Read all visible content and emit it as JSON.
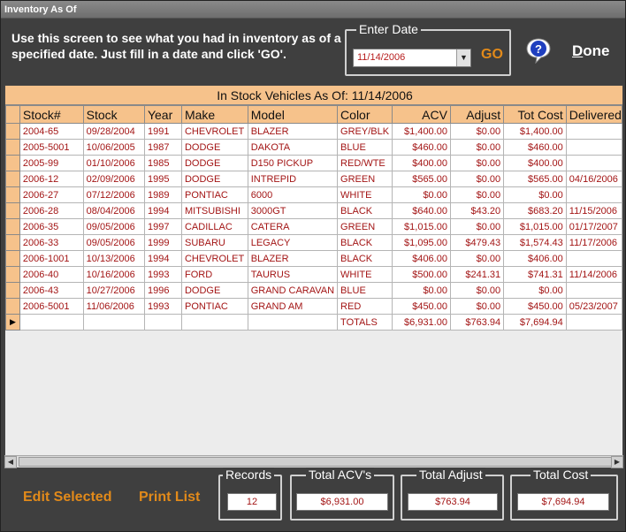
{
  "window": {
    "title": "Inventory As Of"
  },
  "instructions": "Use this screen to see what you had in inventory as of a specified date.  Just fill in a date and click 'GO'.",
  "date_picker": {
    "legend": "Enter Date",
    "value": "11/14/2006",
    "go_label": "GO"
  },
  "done_label_first": "D",
  "done_label_rest": "one",
  "grid": {
    "caption": "In Stock Vehicles As Of: 11/14/2006",
    "columns": [
      "Stock#",
      "Stock",
      "Year",
      "Make",
      "Model",
      "Color",
      "ACV",
      "Adjust",
      "Tot Cost",
      "Delivered"
    ],
    "rows": [
      [
        "2004-65",
        "09/28/2004",
        "1991",
        "CHEVROLET",
        "BLAZER",
        "GREY/BLK",
        "$1,400.00",
        "$0.00",
        "$1,400.00",
        ""
      ],
      [
        "2005-5001",
        "10/06/2005",
        "1987",
        "DODGE",
        "DAKOTA",
        "BLUE",
        "$460.00",
        "$0.00",
        "$460.00",
        ""
      ],
      [
        "2005-99",
        "01/10/2006",
        "1985",
        "DODGE",
        "D150 PICKUP",
        "RED/WTE",
        "$400.00",
        "$0.00",
        "$400.00",
        ""
      ],
      [
        "2006-12",
        "02/09/2006",
        "1995",
        "DODGE",
        "INTREPID",
        "GREEN",
        "$565.00",
        "$0.00",
        "$565.00",
        "04/16/2006"
      ],
      [
        "2006-27",
        "07/12/2006",
        "1989",
        "PONTIAC",
        "6000",
        "WHITE",
        "$0.00",
        "$0.00",
        "$0.00",
        ""
      ],
      [
        "2006-28",
        "08/04/2006",
        "1994",
        "MITSUBISHI",
        "3000GT",
        "BLACK",
        "$640.00",
        "$43.20",
        "$683.20",
        "11/15/2006"
      ],
      [
        "2006-35",
        "09/05/2006",
        "1997",
        "CADILLAC",
        "CATERA",
        "GREEN",
        "$1,015.00",
        "$0.00",
        "$1,015.00",
        "01/17/2007"
      ],
      [
        "2006-33",
        "09/05/2006",
        "1999",
        "SUBARU",
        "LEGACY",
        "BLACK",
        "$1,095.00",
        "$479.43",
        "$1,574.43",
        "11/17/2006"
      ],
      [
        "2006-1001",
        "10/13/2006",
        "1994",
        "CHEVROLET",
        "BLAZER",
        "BLACK",
        "$406.00",
        "$0.00",
        "$406.00",
        ""
      ],
      [
        "2006-40",
        "10/16/2006",
        "1993",
        "FORD",
        "TAURUS",
        "WHITE",
        "$500.00",
        "$241.31",
        "$741.31",
        "11/14/2006"
      ],
      [
        "2006-43",
        "10/27/2006",
        "1996",
        "DODGE",
        "GRAND CARAVAN",
        "BLUE",
        "$0.00",
        "$0.00",
        "$0.00",
        ""
      ],
      [
        "2006-5001",
        "11/06/2006",
        "1993",
        "PONTIAC",
        "GRAND AM",
        "RED",
        "$450.00",
        "$0.00",
        "$450.00",
        "05/23/2007"
      ]
    ],
    "totals": {
      "label": "TOTALS",
      "acv": "$6,931.00",
      "adjust": "$763.94",
      "tot_cost": "$7,694.94"
    }
  },
  "footer": {
    "edit_selected": "Edit Selected",
    "print_list": "Print List",
    "records": {
      "legend": "Records",
      "value": "12"
    },
    "total_acv": {
      "legend": "Total ACV's",
      "value": "$6,931.00"
    },
    "total_adjust": {
      "legend": "Total Adjust",
      "value": "$763.94"
    },
    "total_cost": {
      "legend": "Total Cost",
      "value": "$7,694.94"
    }
  },
  "colors": {
    "accent": "#e28a1a",
    "header_bg": "#f6c28b",
    "cell_text": "#a31515",
    "window_bg": "#3f3f3f"
  },
  "icons": {
    "help": "help-question-icon",
    "dropdown": "chevron-down-icon"
  }
}
